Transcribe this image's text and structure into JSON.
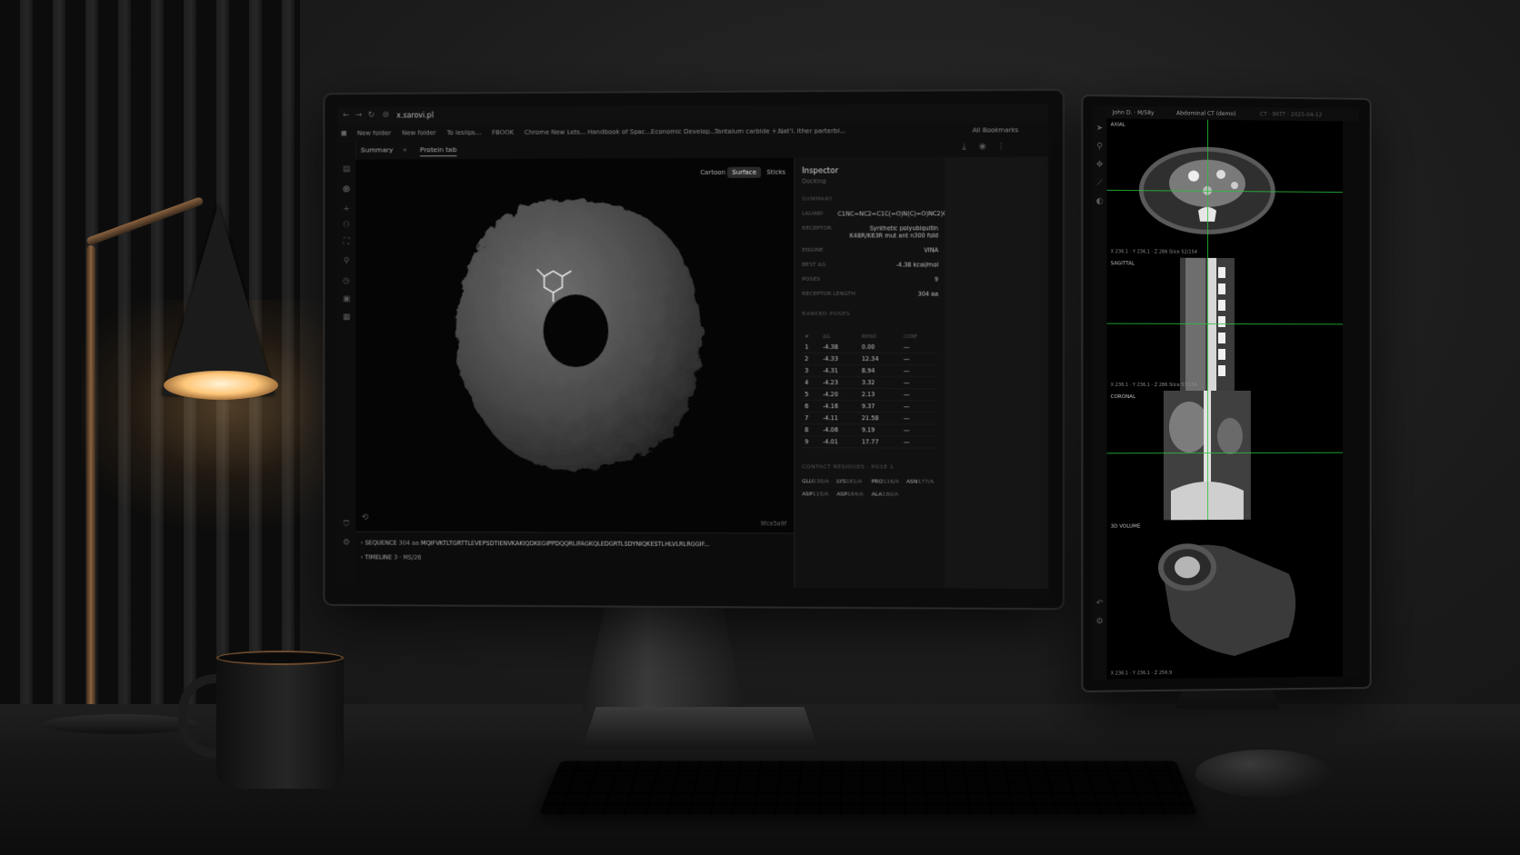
{
  "browser": {
    "url": "x.sarovi.pl",
    "bookmarks": [
      "New folder",
      "New folder",
      "To lesiips...",
      "FBOOK",
      "Chrome New Lets...",
      "Handbook of Spac...",
      "Economic Develop...",
      "Tantalum carbide +...",
      "Nat'l. Ither parterbi..."
    ],
    "all_bookmarks": "All Bookmarks",
    "tabs": [
      "Summary",
      "Protein tab"
    ]
  },
  "viewer": {
    "modes": [
      "Cartoon",
      "Surface",
      "Sticks"
    ],
    "active_mode": "Surface",
    "hash": "9fce5a9f"
  },
  "inspector": {
    "title": "Inspector",
    "subtitle": "Docking",
    "summary_label": "SUMMARY",
    "fields": [
      {
        "k": "LIGAND",
        "v": "C1NC=NC2=C1C(=O)N(C)=O)NC2)C"
      },
      {
        "k": "RECEPTOR",
        "v": "Synthetic polyubiquitin K48R/K63R mut ant n300 fold"
      },
      {
        "k": "ENGINE",
        "v": "VINA"
      },
      {
        "k": "BEST ΔG",
        "v": "-4.38 kcal/mol"
      },
      {
        "k": "POSES",
        "v": "9"
      },
      {
        "k": "RECEPTOR LENGTH",
        "v": "304 aa"
      }
    ],
    "ranked_label": "RANKED POSES",
    "pose_headers": [
      "#",
      "ΔG",
      "RMSD",
      "CONF"
    ],
    "poses": [
      [
        "1",
        "-4.38",
        "0.00",
        "—"
      ],
      [
        "2",
        "-4.33",
        "12.34",
        "—"
      ],
      [
        "3",
        "-4.31",
        "8.94",
        "—"
      ],
      [
        "4",
        "-4.23",
        "3.32",
        "—"
      ],
      [
        "5",
        "-4.20",
        "2.13",
        "—"
      ],
      [
        "6",
        "-4.16",
        "9.37",
        "—"
      ],
      [
        "7",
        "-4.11",
        "21.58",
        "—"
      ],
      [
        "8",
        "-4.06",
        "9.19",
        "—"
      ],
      [
        "9",
        "-4.01",
        "17.77",
        "—"
      ]
    ],
    "contact_label": "CONTACT RESIDUES · POSE 1",
    "residues": [
      {
        "name": "GLU",
        "id": "130/A"
      },
      {
        "name": "LYS",
        "id": "181/A"
      },
      {
        "name": "PRO",
        "id": "116/A"
      },
      {
        "name": "ASN",
        "id": "177/A"
      },
      {
        "name": "ASP",
        "id": "115/A"
      },
      {
        "name": "ASP",
        "id": "184/A"
      },
      {
        "name": "ALA",
        "id": "180/A"
      }
    ]
  },
  "bottom": {
    "sequence_label": "SEQUENCE",
    "sequence_len": "304 aa",
    "sequence": "MQIFVKTLTGRTTLEVEPSDTIENVKAKIQDKEGIPPDQQRLIFAGKQLEDGRTLSDYNIQKESTLHLVLRLRGGIF...",
    "timeline_label": "TIMELINE",
    "timeline_info": "3 · MS/26"
  },
  "ct": {
    "patient": "John D. · M/58y",
    "study": "Abdominal CT (demo)",
    "modality": "CT · 96TT · 2025-04-12",
    "panels": [
      {
        "label": "AXIAL",
        "coord": "X 236.1 · Y 236.1 · Z 286   Slice 52/154"
      },
      {
        "label": "SAGITTAL",
        "coord": "X 236.1 · Y 236.1 · Z 286   Slice 57/154"
      },
      {
        "label": "CORONAL",
        "coord": ""
      },
      {
        "label": "3D VOLUME",
        "coord": "X 236.1 · Y 236.1 · Z 256.9"
      }
    ],
    "crosshair_color": "#27c23a"
  },
  "colors": {
    "lamp_glow": "#ffc77a",
    "screen_bg": "#0b0b0b"
  }
}
